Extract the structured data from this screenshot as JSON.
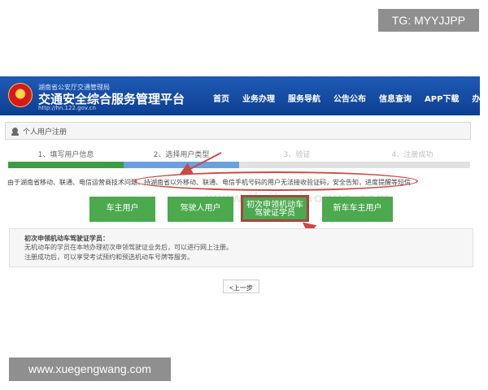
{
  "overlay": {
    "tg_label": "TG: MYYJJPP",
    "website_label": "www.xuegengwang.com"
  },
  "header": {
    "subtitle": "湖南省公安厅交通管理局",
    "title": "交通安全综合服务管理平台",
    "url": "http://hn.122.gov.cn",
    "nav_items": [
      "首页",
      "业务办理",
      "服务导航",
      "公告公布",
      "信息查询",
      "APP下载",
      "办事指南"
    ]
  },
  "breadcrumb": "个人用户注册",
  "steps": [
    {
      "label": "1、填写用户信息",
      "status": "complete"
    },
    {
      "label": "2、选择用户类型",
      "status": "current"
    },
    {
      "label": "3、验证",
      "status": "pending"
    },
    {
      "label": "4、注册成功",
      "status": "pending"
    }
  ],
  "notice": "由于湖南省移动、联通、电信运营商技术问题，持湖南省以外移动、联通、电信手机号码的用户无法接收验证码，安全告知，进度提醒等短信",
  "watermark": "www.jiajiaqiaoxue.com",
  "user_types": {
    "vehicle_owner": "车主用户",
    "driver": "驾驶人用户",
    "learner_line1": "初次申领机动车",
    "learner_line2": "驾驶证学员",
    "new_owner": "新车车主用户"
  },
  "info_box": {
    "title": "初次申领机动车驾驶证学员：",
    "description": "无机动车的学员在本地办理初次申领驾驶证业务后，可以进行网上注册。",
    "note": "注册成功后，可以享受考试预约和预选机动车号牌等服务。"
  },
  "actions": {
    "previous": "<上一步"
  },
  "colors": {
    "header_blue": "#1e5ab4",
    "button_green": "#4ca94e",
    "progress_blue": "#6aa0df",
    "annotation_red": "#c94a43"
  }
}
